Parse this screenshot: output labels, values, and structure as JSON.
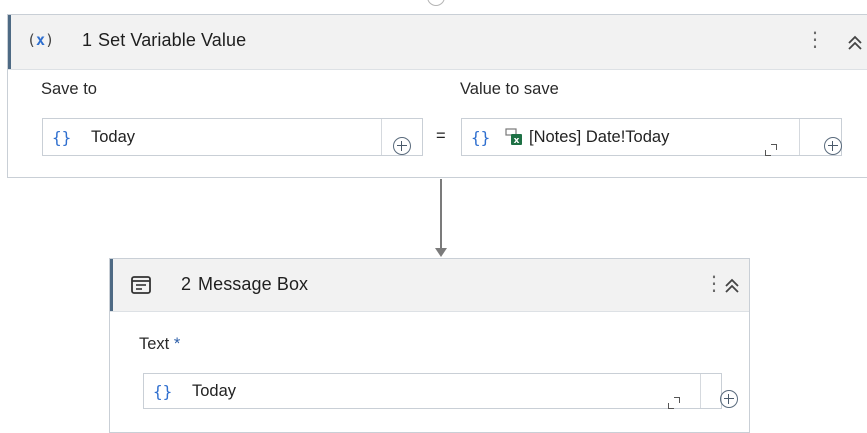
{
  "activity1": {
    "number": "1",
    "title": "Set Variable Value",
    "icon": "(x)",
    "save_to_label": "Save to",
    "value_label": "Value to save",
    "save_to_value": "Today",
    "equals": "=",
    "value_text": "[Notes] Date!Today",
    "brace": "{}"
  },
  "activity2": {
    "number": "2",
    "title": "Message Box",
    "text_label": "Text",
    "required_mark": "*",
    "text_value": "Today",
    "brace": "{}"
  },
  "icons": {
    "kebab": "⋮",
    "collapse": "chevron-double-up-icon",
    "variable": "variable-icon",
    "excel": "excel-icon",
    "message": "message-box-icon"
  },
  "colors": {
    "accent": "#4e6a84",
    "brace": "#2f6fcf",
    "excel": "#1e7145"
  }
}
